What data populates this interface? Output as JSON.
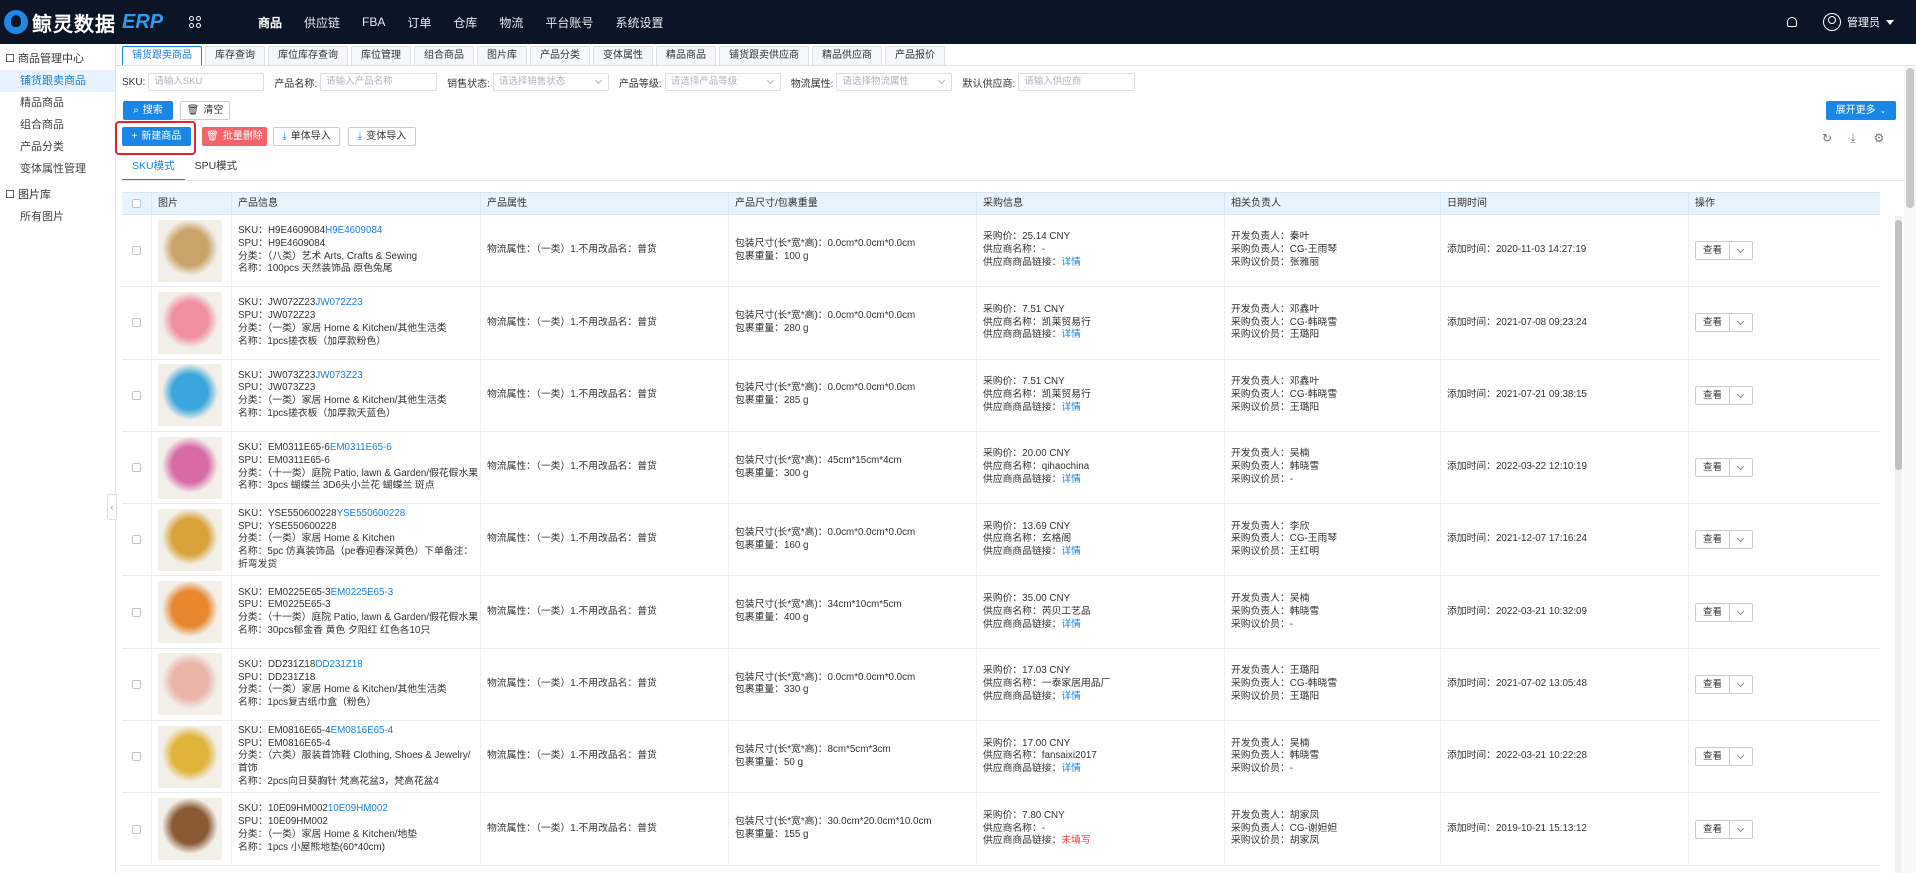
{
  "app": {
    "brand": "鲸灵数据",
    "brand_suffix": "ERP"
  },
  "topnav": [
    "商品",
    "供应链",
    "FBA",
    "订单",
    "仓库",
    "物流",
    "平台账号",
    "系统设置"
  ],
  "user": {
    "name": "管理员"
  },
  "sidebar": {
    "group1": "商品管理中心",
    "items1": [
      "铺货跟卖商品",
      "精品商品",
      "组合商品",
      "产品分类",
      "变体属性管理"
    ],
    "group2": "图片库",
    "items2": [
      "所有图片"
    ]
  },
  "tabs": [
    "铺货跟卖商品",
    "库存查询",
    "库位库存查询",
    "库位管理",
    "组合商品",
    "图片库",
    "产品分类",
    "变体属性",
    "精品商品",
    "铺货跟卖供应商",
    "精品供应商",
    "产品报价"
  ],
  "filters": {
    "sku_label": "SKU:",
    "sku_placeholder": "请输入SKU",
    "name_label": "产品名称:",
    "name_placeholder": "请输入产品名称",
    "sale_label": "销售状态:",
    "sale_placeholder": "请选择销售状态",
    "grade_label": "产品等级:",
    "grade_placeholder": "请选择产品等级",
    "logistic_label": "物流属性:",
    "logistic_placeholder": "请选择物流属性",
    "supplier_label": "默认供应商:",
    "supplier_placeholder": "请输入供应商"
  },
  "buttons": {
    "search": "搜索",
    "clear": "清空",
    "expand": "展开更多",
    "new": "新建商品",
    "batch_delete": "批量删除",
    "single_import": "单体导入",
    "variant_import": "变体导入"
  },
  "subtabs": [
    "SKU模式",
    "SPU模式"
  ],
  "table": {
    "headers": [
      "",
      "图片",
      "产品信息",
      "产品属性",
      "产品尺寸/包裹重量",
      "采购信息",
      "相关负责人",
      "日期时间",
      "操作"
    ],
    "view_label": "查看",
    "rows": [
      {
        "sku": "SKU：H9E4609084",
        "sku_link": "H9E4609084",
        "spu": "SPU：H9E4609084",
        "cat": "分类：（八类）艺术 Arts, Crafts & Sewing",
        "name": "名称：100pcs 天然装饰品 原色兔尾",
        "attr": "物流属性：（一类）1.不用改品名：普货",
        "size": "包装尺寸(长*宽*高)：0.0cm*0.0cm*0.0cm",
        "weight": "包裹重量：100 g",
        "price": "采购价：25.14 CNY",
        "supplier": "供应商名称：-",
        "link_label": "供应商商品链接：",
        "link_val": "详情",
        "dev": "开发负责人：秦叶",
        "buyer": "采购负责人：CG-王雨琴",
        "negotiator": "采购议价员：张雅丽",
        "date": "添加时间：2020-11-03 14:27:19",
        "color": "#c9a36a"
      },
      {
        "sku": "SKU：JW072Z23",
        "sku_link": "JW072Z23",
        "spu": "SPU：JW072Z23",
        "cat": "分类：（一类）家居 Home & Kitchen/其他生活类",
        "name": "名称：1pcs搓衣板（加厚款粉色）",
        "attr": "物流属性：（一类）1.不用改品名：普货",
        "size": "包装尺寸(长*宽*高)：0.0cm*0.0cm*0.0cm",
        "weight": "包裹重量：280 g",
        "price": "采购价：7.51 CNY",
        "supplier": "供应商名称：凯莱贸易行",
        "link_label": "供应商商品链接：",
        "link_val": "详情",
        "dev": "开发负责人：邓鑫叶",
        "buyer": "采购负责人：CG-韩晓雪",
        "negotiator": "采购议价员：王璐阳",
        "date": "添加时间：2021-07-08 09:23:24",
        "color": "#ef8fa0"
      },
      {
        "sku": "SKU：JW073Z23",
        "sku_link": "JW073Z23",
        "spu": "SPU：JW073Z23",
        "cat": "分类：（一类）家居 Home & Kitchen/其他生活类",
        "name": "名称：1pcs搓衣板（加厚款天蓝色）",
        "attr": "物流属性：（一类）1.不用改品名：普货",
        "size": "包装尺寸(长*宽*高)：0.0cm*0.0cm*0.0cm",
        "weight": "包裹重量：285 g",
        "price": "采购价：7.51 CNY",
        "supplier": "供应商名称：凯莱贸易行",
        "link_label": "供应商商品链接：",
        "link_val": "详情",
        "dev": "开发负责人：邓鑫叶",
        "buyer": "采购负责人：CG-韩晓雪",
        "negotiator": "采购议价员：王璐阳",
        "date": "添加时间：2021-07-21 09:38:15",
        "color": "#3aa7dc"
      },
      {
        "sku": "SKU：EM0311E65-6",
        "sku_link": "EM0311E65-6",
        "spu": "SPU：EM0311E65-6",
        "cat": "分类：（十一类）庭院 Patio, lawn & Garden/假花假水果",
        "name": "名称：3pcs 蝴蝶兰 3D6头小兰花 蝴蝶兰 斑点",
        "attr": "物流属性：（一类）1.不用改品名：普货",
        "size": "包装尺寸(长*宽*高)：45cm*15cm*4cm",
        "weight": "包裹重量：300 g",
        "price": "采购价：20.00 CNY",
        "supplier": "供应商名称：qihaochina",
        "link_label": "供应商商品链接：",
        "link_val": "详情",
        "dev": "开发负责人：吴楠",
        "buyer": "采购负责人：韩晓雪",
        "negotiator": "采购议价员：-",
        "date": "添加时间：2022-03-22 12:10:19",
        "color": "#d86aa6"
      },
      {
        "sku": "SKU：YSE550600228",
        "sku_link": "YSE550600228",
        "spu": "SPU：YSE550600228",
        "cat": "分类：（一类）家居 Home & Kitchen",
        "name": "名称：5pc 仿真装饰品（pe春迎春深黄色）下单备注：折弯发货",
        "attr": "物流属性：（一类）1.不用改品名：普货",
        "size": "包装尺寸(长*宽*高)：0.0cm*0.0cm*0.0cm",
        "weight": "包裹重量：160 g",
        "price": "采购价：13.69 CNY",
        "supplier": "供应商名称：玄格阁",
        "link_label": "供应商商品链接：",
        "link_val": "详情",
        "dev": "开发负责人：李欣",
        "buyer": "采购负责人：CG-王雨琴",
        "negotiator": "采购议价员：王红明",
        "date": "添加时间：2021-12-07 17:16:24",
        "color": "#d8a33a"
      },
      {
        "sku": "SKU：EM0225E65-3",
        "sku_link": "EM0225E65-3",
        "spu": "SPU：EM0225E65-3",
        "cat": "分类：（十一类）庭院 Patio, lawn & Garden/假花假水果",
        "name": "名称：30pcs郁金香 黄色 夕阳红 红色各10只",
        "attr": "物流属性：（一类）1.不用改品名：普货",
        "size": "包装尺寸(长*宽*高)：34cm*10cm*5cm",
        "weight": "包裹重量：400 g",
        "price": "采购价：35.00 CNY",
        "supplier": "供应商名称：芮贝工艺品",
        "link_label": "供应商商品链接：",
        "link_val": "详情",
        "dev": "开发负责人：吴楠",
        "buyer": "采购负责人：韩晓雪",
        "negotiator": "采购议价员：-",
        "date": "添加时间：2022-03-21 10:32:09",
        "color": "#e8872e"
      },
      {
        "sku": "SKU：DD231Z18",
        "sku_link": "DD231Z18",
        "spu": "SPU：DD231Z18",
        "cat": "分类：（一类）家居 Home & Kitchen/其他生活类",
        "name": "名称：1pcs复古纸巾盒（粉色）",
        "attr": "物流属性：（一类）1.不用改品名：普货",
        "size": "包装尺寸(长*宽*高)：0.0cm*0.0cm*0.0cm",
        "weight": "包裹重量：330 g",
        "price": "采购价：17.03 CNY",
        "supplier": "供应商名称：一泰家居用品厂",
        "link_label": "供应商商品链接：",
        "link_val": "详情",
        "dev": "开发负责人：王璐阳",
        "buyer": "采购负责人：CG-韩晓雪",
        "negotiator": "采购议价员：王璐阳",
        "date": "添加时间：2021-07-02 13:05:48",
        "color": "#eab4a8"
      },
      {
        "sku": "SKU：EM0816E65-4",
        "sku_link": "EM0816E65-4",
        "spu": "SPU：EM0816E65-4",
        "cat": "分类：（六类）服装首饰鞋 Clothing, Shoes & Jewelry/首饰",
        "name": "名称：2pcs向日葵胸针 梵高花盆3，梵高花盆4",
        "attr": "物流属性：（一类）1.不用改品名：普货",
        "size": "包装尺寸(长*宽*高)：8cm*5cm*3cm",
        "weight": "包裹重量：50 g",
        "price": "采购价：17.00 CNY",
        "supplier": "供应商名称：fansaixi2017",
        "link_label": "供应商商品链接：",
        "link_val": "详情",
        "dev": "开发负责人：吴楠",
        "buyer": "采购负责人：韩晓雪",
        "negotiator": "采购议价员：-",
        "date": "添加时间：2022-03-21 10:22:28",
        "color": "#e0b43a"
      },
      {
        "sku": "SKU：10E09HM002",
        "sku_link": "10E09HM002",
        "spu": "SPU：10E09HM002",
        "cat": "分类：（一类）家居 Home & Kitchen/地垫",
        "name": "名称：1pcs 小屋熊地垫(60*40cm)",
        "attr": "物流属性：（一类）1.不用改品名：普货",
        "size": "包装尺寸(长*宽*高)：30.0cm*20.0cm*10.0cm",
        "weight": "包裹重量：155 g",
        "price": "采购价：7.80 CNY",
        "supplier": "供应商名称：-",
        "link_label": "供应商商品链接：",
        "link_val": "未填写",
        "dev": "开发负责人：胡家凤",
        "buyer": "采购负责人：CG-谢妲妲",
        "negotiator": "采购议价员：胡家凤",
        "date": "添加时间：2019-10-21 15:13:12",
        "color": "#8a5a34"
      }
    ]
  }
}
